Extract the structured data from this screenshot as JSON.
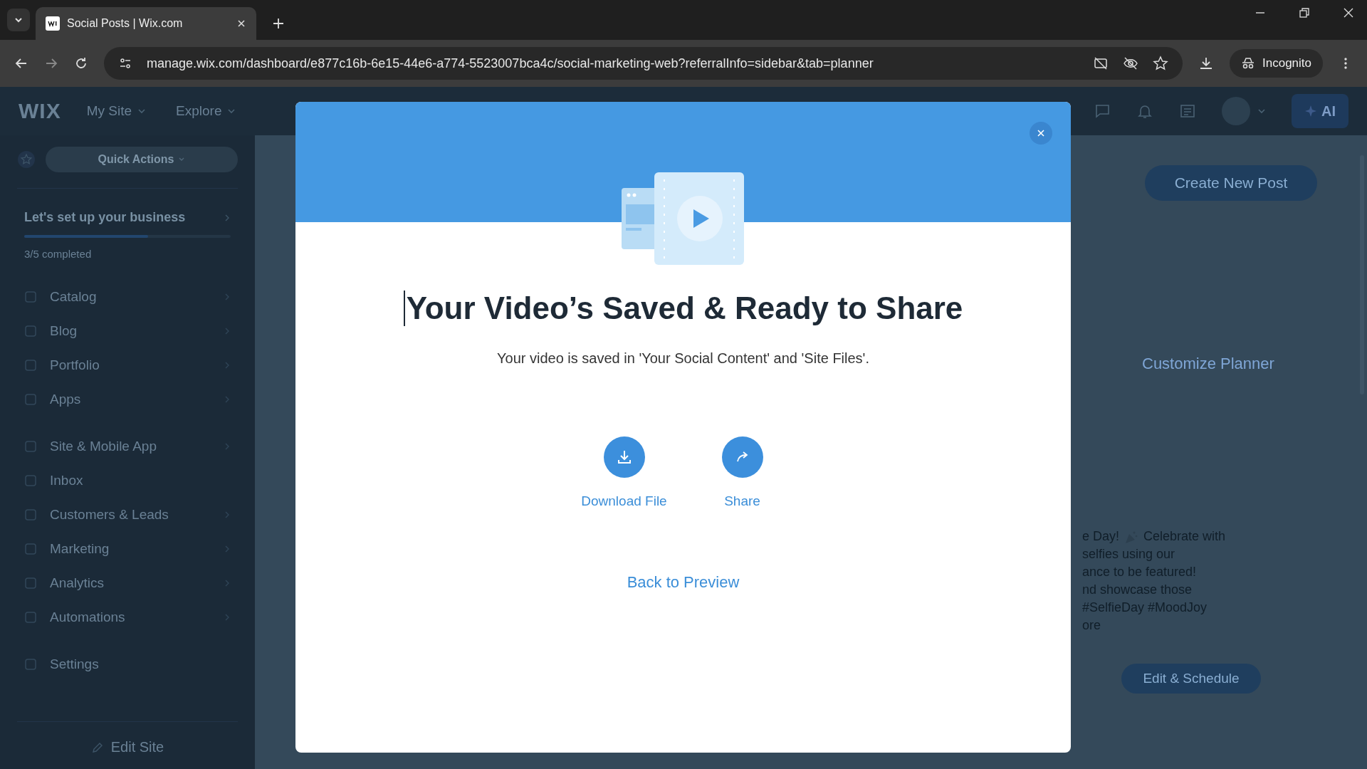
{
  "browser": {
    "tab_title": "Social Posts | Wix.com",
    "url": "manage.wix.com/dashboard/e877c16b-6e15-44e6-a774-5523007bca4c/social-marketing-web?referralInfo=sidebar&tab=planner",
    "profile": "Incognito"
  },
  "topbar": {
    "logo": "WIX",
    "menus": [
      "My Site",
      "Explore"
    ],
    "ai_button": "AI"
  },
  "sidebar": {
    "quick_actions": "Quick Actions",
    "setup": {
      "title": "Let's set up your business",
      "level": 0.6,
      "progress": "3/5 completed"
    },
    "groups": [
      [
        {
          "label": "Catalog",
          "expandable": true
        },
        {
          "label": "Blog",
          "expandable": true
        },
        {
          "label": "Portfolio",
          "expandable": true
        },
        {
          "label": "Apps",
          "expandable": true
        }
      ],
      [
        {
          "label": "Site & Mobile App",
          "expandable": true
        },
        {
          "label": "Inbox",
          "expandable": false
        },
        {
          "label": "Customers & Leads",
          "expandable": true
        },
        {
          "label": "Marketing",
          "expandable": true
        },
        {
          "label": "Analytics",
          "expandable": true
        },
        {
          "label": "Automations",
          "expandable": true
        }
      ],
      [
        {
          "label": "Settings",
          "expandable": false
        }
      ]
    ],
    "footer": "Edit Site"
  },
  "main": {
    "create_button": "Create New Post",
    "customize_link": "Customize Planner",
    "post": {
      "first_line": [
        "e Day!",
        "Celebrate with"
      ],
      "lines": [
        "selfies using our",
        "ance to be featured!",
        "nd showcase those",
        "#SelfieDay #MoodJoy",
        "ore"
      ],
      "button": "Edit & Schedule"
    }
  },
  "modal": {
    "title": "Your Video’s Saved & Ready to Share",
    "subtitle": "Your video is saved in 'Your Social Content' and 'Site Files'.",
    "actions": [
      {
        "kind": "download",
        "label": "Download File"
      },
      {
        "kind": "share",
        "label": "Share"
      }
    ],
    "back_link": "Back to Preview"
  }
}
